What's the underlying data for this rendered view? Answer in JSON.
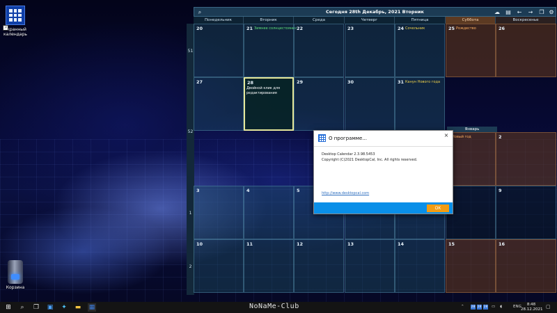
{
  "desktop": {
    "calendar_icon_label": "Экранный календарь",
    "recycle_label": "Корзина"
  },
  "calendar": {
    "title": "Сегодня 28th Декабрь, 2021 Вторник",
    "day_names": [
      "Понедельник",
      "Вторник",
      "Среда",
      "Четверг",
      "Пятница",
      "Суббота",
      "Воскресенье"
    ],
    "week_numbers": [
      "51",
      "52",
      "1",
      "2"
    ],
    "next_month_label": "Январь",
    "rows": [
      [
        {
          "num": "20",
          "ev": ""
        },
        {
          "num": "21",
          "ev": "Зимнее солнцестояние"
        },
        {
          "num": "22",
          "ev": ""
        },
        {
          "num": "23",
          "ev": ""
        },
        {
          "num": "24",
          "ev": "Сочельник"
        },
        {
          "num": "25",
          "ev": "Рождество"
        },
        {
          "num": "26",
          "ev": ""
        }
      ],
      [
        {
          "num": "27",
          "ev": ""
        },
        {
          "num": "28",
          "ev": ""
        },
        {
          "num": "29",
          "ev": ""
        },
        {
          "num": "30",
          "ev": ""
        },
        {
          "num": "31",
          "ev": "Канун Нового года"
        },
        {
          "num": "",
          "ev": ""
        },
        {
          "num": "",
          "ev": ""
        }
      ],
      [
        {
          "num": "",
          "ev": ""
        },
        {
          "num": "",
          "ev": ""
        },
        {
          "num": "",
          "ev": ""
        },
        {
          "num": "",
          "ev": ""
        },
        {
          "num": "",
          "ev": ""
        },
        {
          "num": "",
          "ev": "Новый год"
        },
        {
          "num": "2",
          "ev": ""
        }
      ],
      [
        {
          "num": "3",
          "ev": ""
        },
        {
          "num": "4",
          "ev": ""
        },
        {
          "num": "5",
          "ev": ""
        },
        {
          "num": "",
          "ev": ""
        },
        {
          "num": "",
          "ev": ""
        },
        {
          "num": "",
          "ev": ""
        },
        {
          "num": "9",
          "ev": ""
        }
      ],
      [
        {
          "num": "10",
          "ev": ""
        },
        {
          "num": "11",
          "ev": ""
        },
        {
          "num": "12",
          "ev": ""
        },
        {
          "num": "13",
          "ev": ""
        },
        {
          "num": "14",
          "ev": ""
        },
        {
          "num": "15",
          "ev": ""
        },
        {
          "num": "16",
          "ev": ""
        }
      ]
    ],
    "today_note": "Двойной клик для редактирования"
  },
  "dialog": {
    "title": "О программе...",
    "version": "Desktop Calendar 2.3.98.5453",
    "copyright": "Copyright (C)2021 DesktopCal, Inc. All rights reserved.",
    "link": "http://www.desktopcal.com",
    "ok": "OK",
    "close_glyph": "×"
  },
  "taskbar": {
    "brand": "NoNaMe-Club",
    "lang": "ENG",
    "time": "8:48",
    "date": "28.12.2021",
    "mini_badges": [
      "28",
      "28",
      "28"
    ]
  },
  "colors": {
    "weekend": "#5c3a22",
    "accent": "#0a8fe8",
    "ok_button": "#f39c12"
  }
}
